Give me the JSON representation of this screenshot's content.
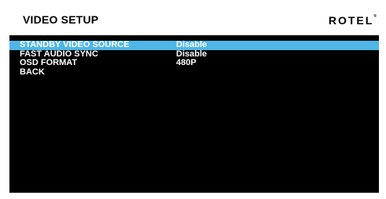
{
  "header": {
    "title": "VIDEO SETUP",
    "brand": "ROTEL",
    "trademark": "®"
  },
  "menu": {
    "items": [
      {
        "label": "STANDBY VIDEO SOURCE",
        "value": "Disable",
        "selected": true
      },
      {
        "label": "FAST AUDIO SYNC",
        "value": "Disable",
        "selected": false
      },
      {
        "label": "OSD FORMAT",
        "value": "480P",
        "selected": false
      },
      {
        "label": "BACK",
        "value": "",
        "selected": false
      }
    ]
  },
  "colors": {
    "highlight": "#4fb6e6",
    "background": "#000000",
    "header_background": "#ffffff",
    "text": "#ffffff"
  }
}
